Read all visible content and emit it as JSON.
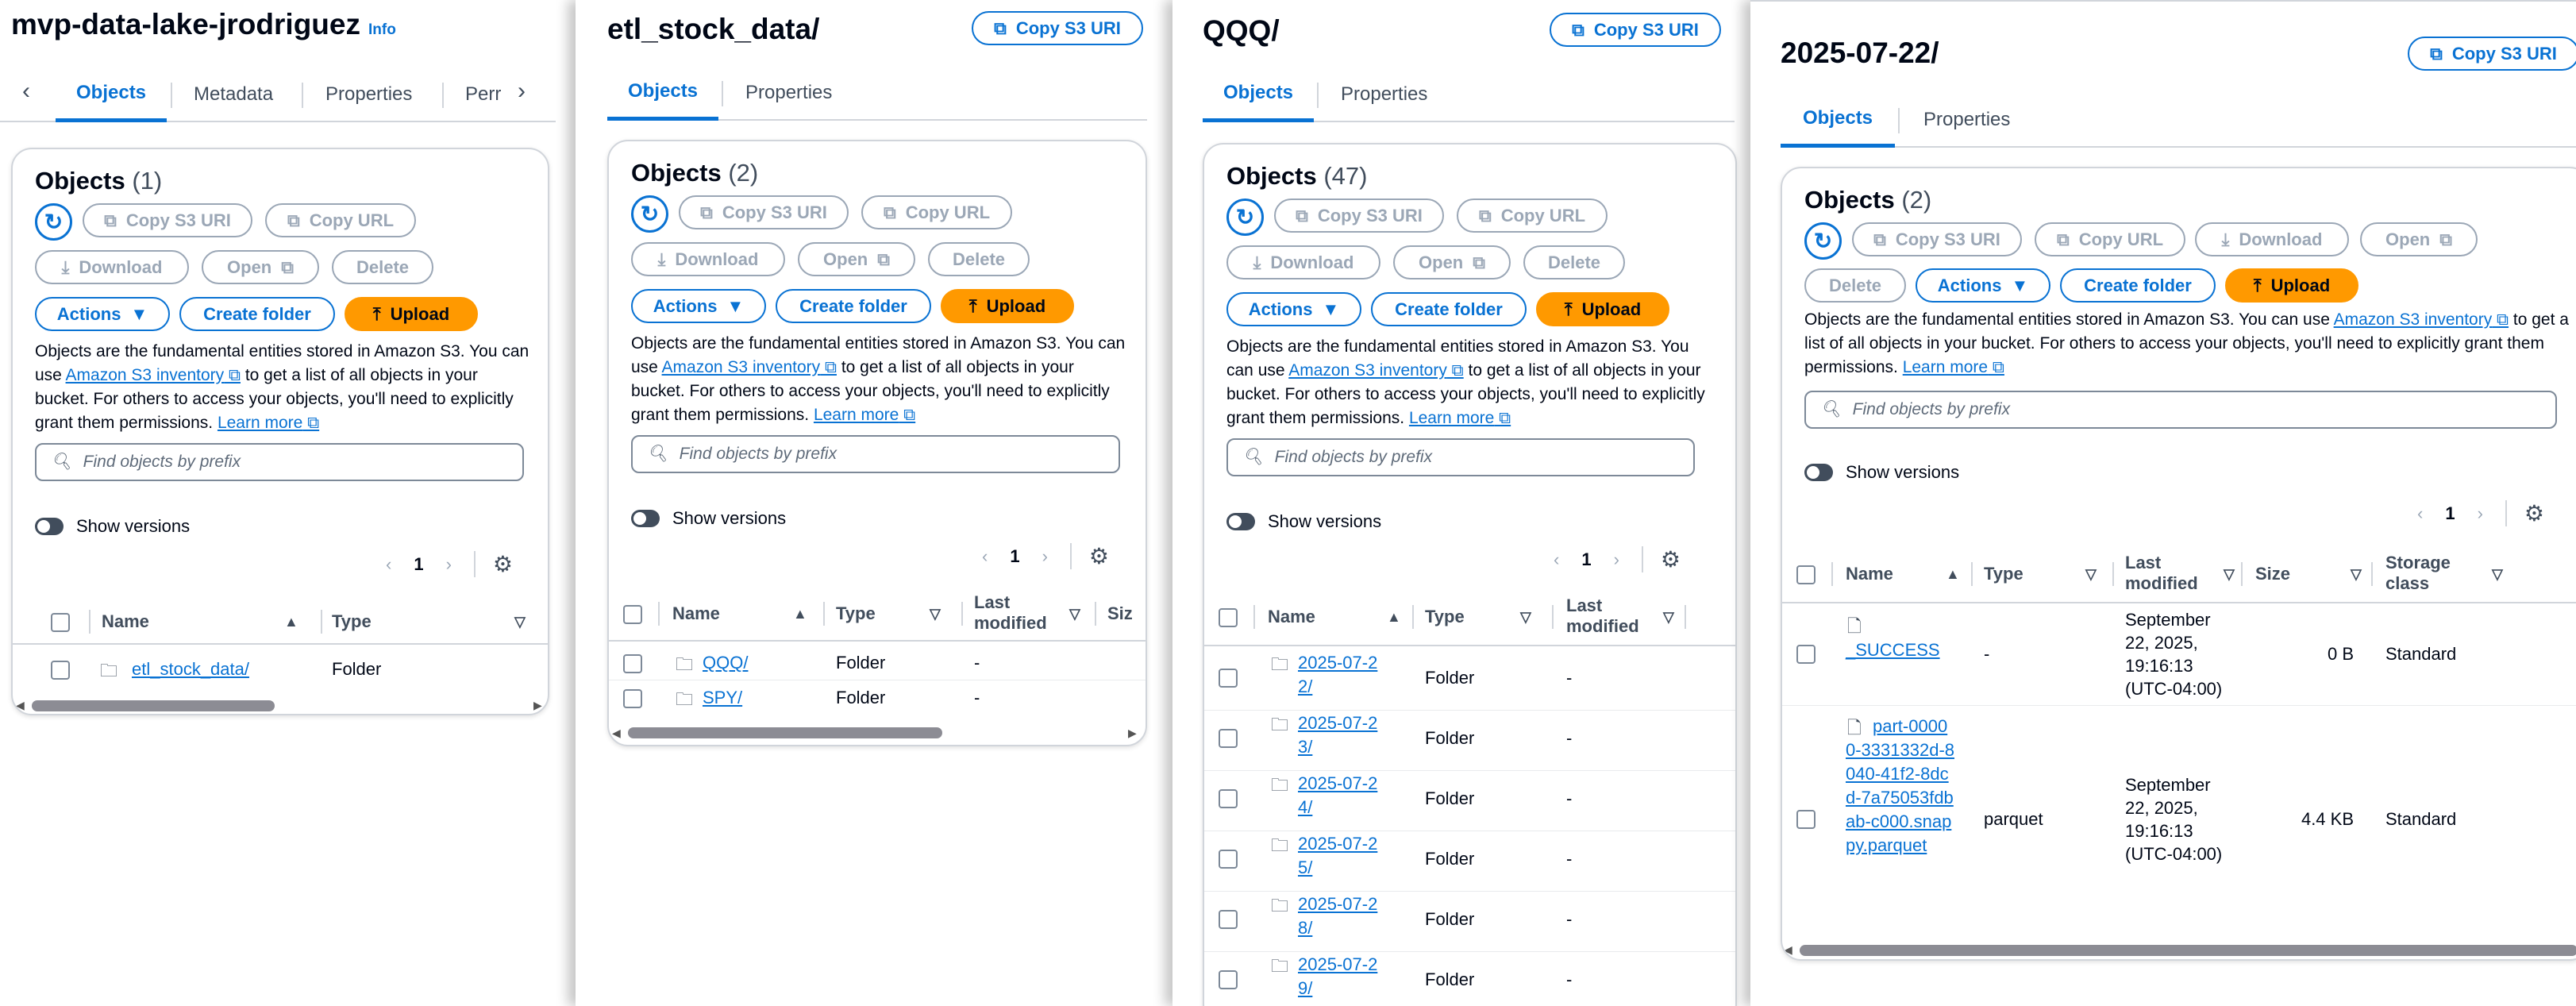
{
  "common": {
    "copy_s3_uri": "Copy S3 URI",
    "copy_url": "Copy URL",
    "download": "Download",
    "open": "Open",
    "delete": "Delete",
    "actions": "Actions",
    "create_folder": "Create folder",
    "upload": "Upload",
    "objects_title": "Objects",
    "desc_pre": "Objects are the fundamental entities stored in Amazon S3. You can use ",
    "desc_link1": "Amazon S3 inventory",
    "desc_mid": " to get a list of all objects in your bucket. For others to access your objects, you'll need to explicitly grant them permissions. ",
    "desc_link2": "Learn more",
    "search_placeholder": "Find objects by prefix",
    "show_versions": "Show versions",
    "page_number": "1",
    "col_name": "Name",
    "col_type": "Type",
    "col_last_modified": "Last modified",
    "col_size": "Size",
    "col_storage_class": "Storage class",
    "col_size_cut": "Siz",
    "tab_objects": "Objects",
    "tab_metadata": "Metadata",
    "tab_properties": "Properties",
    "tab_permissions_cut": "Perr"
  },
  "colors": {
    "accent": "#0972d3",
    "upload": "#ff9900",
    "disabled": "#9ba7b6"
  },
  "panel1": {
    "title": "mvp-data-lake-jrodriguez",
    "info": "Info",
    "count": "(1)",
    "rows": [
      {
        "name": "etl_stock_data/",
        "type": "Folder"
      }
    ]
  },
  "panel2": {
    "title": "etl_stock_data/",
    "count": "(2)",
    "rows": [
      {
        "name": "QQQ/",
        "type": "Folder",
        "modified": "-"
      },
      {
        "name": "SPY/",
        "type": "Folder",
        "modified": "-"
      }
    ]
  },
  "panel3": {
    "title": "QQQ/",
    "count": "(47)",
    "rows": [
      {
        "name": "2025-07-22/",
        "type": "Folder",
        "modified": "-"
      },
      {
        "name": "2025-07-23/",
        "type": "Folder",
        "modified": "-"
      },
      {
        "name": "2025-07-24/",
        "type": "Folder",
        "modified": "-"
      },
      {
        "name": "2025-07-25/",
        "type": "Folder",
        "modified": "-"
      },
      {
        "name": "2025-07-28/",
        "type": "Folder",
        "modified": "-"
      },
      {
        "name": "2025-07-29/",
        "type": "Folder",
        "modified": "-"
      }
    ]
  },
  "panel4": {
    "title": "2025-07-22/",
    "count": "(2)",
    "rows": [
      {
        "name": "_SUCCESS",
        "type": "-",
        "modified": "September 22, 2025, 19:16:13 (UTC-04:00)",
        "size": "0 B",
        "storage": "Standard"
      },
      {
        "name": "part-00000-3331332d-8040-41f2-8dcd-7a75053fdbab-c000.snappy.parquet",
        "type": "parquet",
        "modified": "September 22, 2025, 19:16:13 (UTC-04:00)",
        "size": "4.4 KB",
        "storage": "Standard"
      }
    ]
  }
}
